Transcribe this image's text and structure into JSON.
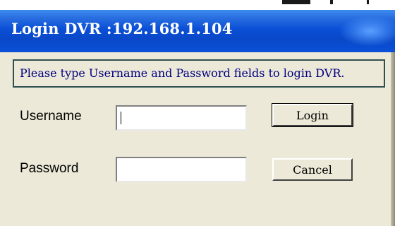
{
  "window": {
    "title": "Login DVR :192.168.1.104"
  },
  "message": "Please type Username and Password fields to login DVR.",
  "form": {
    "username_label": "Username",
    "username_value": "",
    "password_label": "Password",
    "password_value": ""
  },
  "buttons": {
    "login_label": "Login",
    "cancel_label": "Cancel"
  },
  "colors": {
    "titlebar": "#0a4fd6",
    "title_text": "#ffffff",
    "dialog_bg": "#ece9d8",
    "message_text": "#000080"
  }
}
